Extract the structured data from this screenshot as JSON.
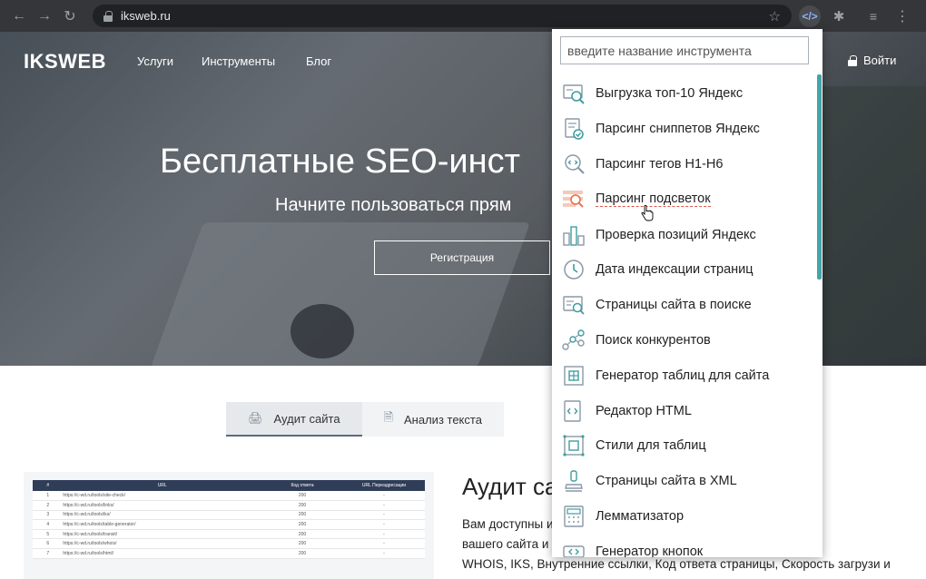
{
  "browser": {
    "url": "iksweb.ru",
    "icons": [
      "back-icon",
      "forward-icon",
      "reload-icon",
      "lock-icon",
      "star-icon",
      "extension-code-icon",
      "puzzle-icon",
      "media-icon",
      "menu-icon"
    ]
  },
  "site": {
    "logo": "IKSWEB",
    "nav": [
      "Услуги",
      "Инструменты",
      "Блог"
    ],
    "login": "Войти",
    "hero_title": "Бесплатные SEO-инст",
    "hero_subtitle": "Начните пользоваться прям",
    "register_button": "Регистрация"
  },
  "tabs": [
    {
      "label": "Аудит сайта",
      "icon": "monitor-icon",
      "active": true
    },
    {
      "label": "Анализ текста",
      "icon": "document-icon",
      "active": false
    }
  ],
  "preview_table": {
    "headers": [
      "#",
      "URL",
      "Код ответа",
      "URL Переадресации"
    ],
    "rows": [
      [
        "1",
        "https://c-wd.ru/tools/site-check/",
        "200",
        "-"
      ],
      [
        "2",
        "https://c-wd.ru/tools/links/",
        "200",
        "-"
      ],
      [
        "3",
        "https://c-wd.ru/tools/iks/",
        "200",
        "-"
      ],
      [
        "4",
        "https://c-wd.ru/tools/table-generator/",
        "200",
        "-"
      ],
      [
        "5",
        "https://c-wd.ru/tools/transit/",
        "200",
        "-"
      ],
      [
        "6",
        "https://c-wd.ru/tools/whois/",
        "200",
        "-"
      ],
      [
        "7",
        "https://c-wd.ru/tools/html/",
        "200",
        "-"
      ]
    ]
  },
  "content": {
    "title": "Аудит са",
    "lines": [
      "Вам доступны и                                      ный анализ",
      "вашего сайта и                                     е проверить",
      "WHOIS, IKS, Внутренние ссылки, Код ответа страницы, Скорость загрузи и"
    ]
  },
  "popup": {
    "search_placeholder": "введите название инструмента",
    "accent_color": "#43a5a7",
    "tools": [
      {
        "label": "Выгрузка топ-10 Яндекс",
        "icon": "top10-icon"
      },
      {
        "label": "Парсинг сниппетов Яндекс",
        "icon": "snippet-icon"
      },
      {
        "label": "Парсинг тегов H1-H6",
        "icon": "tag-search-icon"
      },
      {
        "label": "Парсинг подсветок",
        "icon": "highlight-search-icon",
        "hover": true
      },
      {
        "label": "Проверка позиций Яндекс",
        "icon": "positions-icon"
      },
      {
        "label": "Дата индексации страниц",
        "icon": "clock-icon"
      },
      {
        "label": "Страницы сайта в поиске",
        "icon": "pages-search-icon"
      },
      {
        "label": "Поиск конкурентов",
        "icon": "network-icon"
      },
      {
        "label": "Генератор таблиц для сайта",
        "icon": "table-gen-icon"
      },
      {
        "label": "Редактор HTML",
        "icon": "html-editor-icon"
      },
      {
        "label": "Стили для таблиц",
        "icon": "table-style-icon"
      },
      {
        "label": "Страницы сайта в XML",
        "icon": "xml-stamp-icon"
      },
      {
        "label": "Лемматизатор",
        "icon": "lemmatizer-icon"
      },
      {
        "label": "Генератор кнопок",
        "icon": "button-gen-icon"
      }
    ]
  }
}
